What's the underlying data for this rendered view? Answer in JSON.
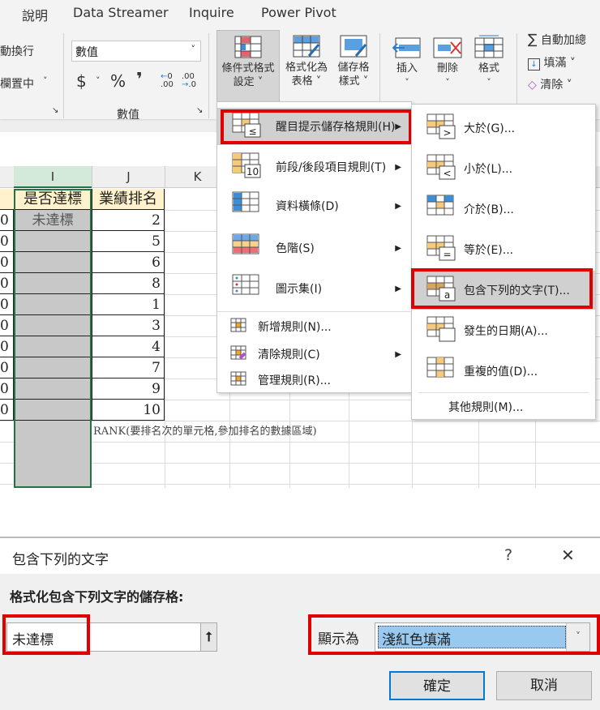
{
  "ribbon": {
    "tabs": [
      "說明",
      "Data Streamer",
      "Inquire",
      "Power Pivot"
    ],
    "wrap_text": "動換行",
    "merge_center": "欄置中",
    "number_format": "數值",
    "currency": "$",
    "percent": "%",
    "comma": "❜",
    "inc_decimal": ".00",
    "dec_decimal": ".00",
    "number_group": "數值",
    "cond_format": [
      "條件式格式",
      "設定 ˅"
    ],
    "format_table": [
      "格式化為",
      "表格 ˅"
    ],
    "cell_styles": [
      "儲存格",
      "樣式 ˅"
    ],
    "insert": "插入",
    "delete": "刪除",
    "format": "格式",
    "autosum": "自動加總",
    "fill": "填滿 ˅",
    "clear": "清除 ˅"
  },
  "sheet": {
    "columns": [
      "I",
      "J",
      "K"
    ],
    "headers": [
      "是否達標",
      "業績排名"
    ],
    "left_col": [
      "0",
      "0",
      "0",
      "0",
      "0",
      "0",
      "0",
      "0",
      "0",
      "0"
    ],
    "status": [
      "未達標",
      "",
      "",
      "",
      "",
      "",
      "",
      "",
      "",
      ""
    ],
    "ranks": [
      "2",
      "5",
      "6",
      "8",
      "1",
      "3",
      "4",
      "7",
      "9",
      "10"
    ],
    "note": "RANK(要排名次的單元格,參加排名的數據區域)"
  },
  "menu": {
    "items": [
      {
        "label": "醒目提示儲存格規則(H)",
        "icon": "highlight-rules-icon"
      },
      {
        "label": "前段/後段項目規則(T)",
        "icon": "top-bottom-icon"
      },
      {
        "label": "資料橫條(D)",
        "icon": "data-bars-icon"
      },
      {
        "label": "色階(S)",
        "icon": "color-scales-icon"
      },
      {
        "label": "圖示集(I)",
        "icon": "icon-sets-icon"
      }
    ],
    "small_items": [
      "新增規則(N)...",
      "清除規則(C)",
      "管理規則(R)..."
    ]
  },
  "submenu": {
    "items": [
      "大於(G)...",
      "小於(L)...",
      "介於(B)...",
      "等於(E)...",
      "包含下列的文字(T)...",
      "發生的日期(A)...",
      "重複的值(D)..."
    ],
    "glyphs": [
      ">",
      "<",
      "",
      "=",
      "a",
      "",
      ""
    ],
    "more": "其他規則(M)..."
  },
  "dialog": {
    "title": "包含下列的文字",
    "help": "?",
    "close": "✕",
    "label": "格式化包含下列文字的儲存格:",
    "text_value": "未達標",
    "display_label": "顯示為",
    "format_value": "淺紅色填滿",
    "ok": "確定",
    "cancel": "取消"
  },
  "colors": {
    "highlight_red": "#e00000",
    "selection": "#99c9ef",
    "header_fill": "#fff2cc",
    "gray_fill": "#c8c8c8"
  }
}
